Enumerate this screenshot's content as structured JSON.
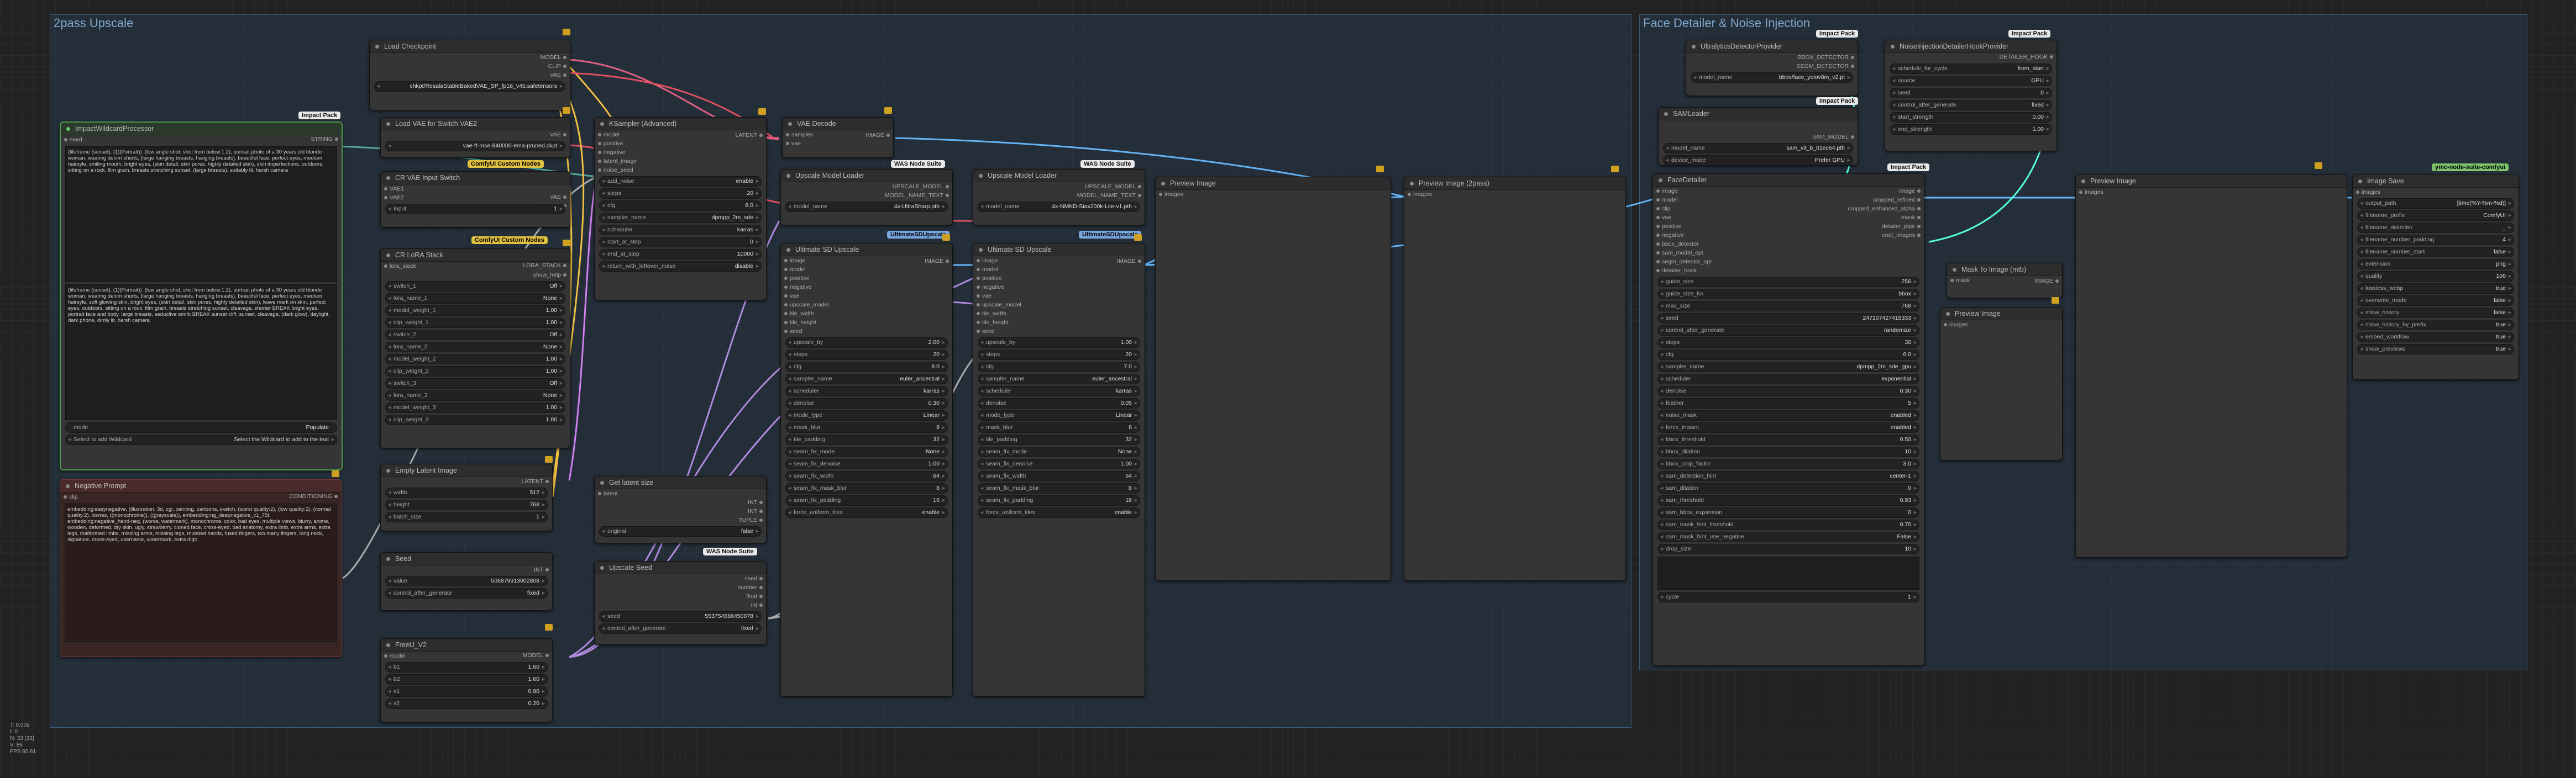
{
  "groups": {
    "upscale_title": "2pass Upscale",
    "face_title": "Face Detailer & Noise Injection"
  },
  "badges": {
    "impact_pack": "Impact Pack",
    "was_node_suite": "WAS Node Suite",
    "comfyui_custom_nodes": "ComfyUI Custom Nodes",
    "ultimate_sd_upscale": "UltimateSDUpscale",
    "ymc_node_suite": "ymc-node-suite-comfyui"
  },
  "nodes": {
    "load_checkpoint": {
      "title": "Load Checkpoint",
      "outputs": [
        "MODEL",
        "CLIP",
        "VAE"
      ],
      "ckpt_name": "chkpt/ResalaStableBakedVAE_SP_fp16_v45.safetensors"
    },
    "load_vae": {
      "title": "Load VAE for Switch VAE2",
      "output": "VAE",
      "vae_name": "vae-ft-mse-840000-ema-pruned.ckpt"
    },
    "vae_switch": {
      "title": "CR VAE Input Switch",
      "inputs": [
        "VAE1",
        "VAE2"
      ],
      "outputs": [
        "VAE",
        "show_help"
      ],
      "input_label": "Input",
      "input_value": "1"
    },
    "lora_stack": {
      "title": "CR LoRA Stack",
      "input": "lora_stack",
      "outputs": [
        "LORA_STACK",
        "show_help"
      ],
      "rows": [
        {
          "label": "switch_1",
          "value": "Off"
        },
        {
          "label": "lora_name_1",
          "value": "None"
        },
        {
          "label": "model_weight_1",
          "value": "1.00"
        },
        {
          "label": "clip_weight_1",
          "value": "1.00"
        },
        {
          "label": "switch_2",
          "value": "Off"
        },
        {
          "label": "lora_name_2",
          "value": "None"
        },
        {
          "label": "model_weight_2",
          "value": "1.00"
        },
        {
          "label": "clip_weight_2",
          "value": "1.00"
        },
        {
          "label": "switch_3",
          "value": "Off"
        },
        {
          "label": "lora_name_3",
          "value": "None"
        },
        {
          "label": "model_weight_3",
          "value": "1.00"
        },
        {
          "label": "clip_weight_3",
          "value": "1.00"
        }
      ]
    },
    "wildcard": {
      "title": "ImpactWildcardProcessor",
      "input": "seed",
      "output": "STRING",
      "text1": "(lifeframe (sunset), (1)(Portrait)) ,(low angle shot, shot from below:1.2), portrait photo of a 30 years old blonde woman, wearing denim shorts, (large hanging breasts, hanging breasts), beautiful face, perfect eyes, medium hairsyle, smiling mouth, bright eyes, (skin detail, skin pores, highly detailed skin), skin imperfections, outdoors, sitting on a rock, film grain, breasts stretching sunset, (large breasts), suitably lit, harsh camera",
      "text2": "(lifeframe (sunset), (1)(Portrait)) ,(low angle shot, shot from below:1.2), portrait photo of a 30 years old blonde woman, wearing denim shorts, (large hanging breasts, hanging breasts), beautiful face, perfect eyes, medium hairsyle, soft glowing skin, bright eyes, (skin detail, skin pores, highly detailed skin), leave mark on skin, perfect eyes, outdoors, sitting on a rock, film grain, breasts stretching sunset, cleavage, shorter BREAK bright eyes, portrait face and body, large breasts, seductive smirk BREAK sunset cliff, sunset, cleavage, (dark glow), daylight, dark phone, dimly lit, harsh camera",
      "mode_label": "mode",
      "mode_value": "Populate",
      "select_label": "Select to add Wildcard",
      "select_value": "Select the Wildcard to add to the text"
    },
    "negative": {
      "title": "Negative Prompt",
      "input": "clip",
      "output": "CONDITIONING",
      "text": "embedding:easynegative, (illustration, 3d, cgi, painting, cartoons, sketch, (worst quality:2), (low quality:2), (normal quality:2), lowres, ((monochrome)), ((grayscale)), embedding:ng_deepnegative_v1_75t, embedding:negative_hand-neg, (worse, watermark), monochrome, color, bad eyes, multiple views, blurry, anime, wooden, deformed, dry skin, ugly, strawberry, cloned face, cross-eyed, bad anatomy, extra limb, extra arms, extra legs, malformed limbs, missing arms, missing legs, mutated hands, fused fingers, too many fingers, long neck, signature, cross-eyed, username, watermark, extra digit"
    },
    "ksampler": {
      "title": "KSampler (Advanced)",
      "inputs": [
        "model",
        "positive",
        "negative",
        "latent_image",
        "noise_seed"
      ],
      "output": "LATENT",
      "rows": [
        {
          "label": "add_noise",
          "value": "enable"
        },
        {
          "label": "steps",
          "value": "20"
        },
        {
          "label": "cfg",
          "value": "8.0"
        },
        {
          "label": "sampler_name",
          "value": "dpmpp_2m_sde"
        },
        {
          "label": "scheduler",
          "value": "karras"
        },
        {
          "label": "start_at_step",
          "value": "0"
        },
        {
          "label": "end_at_step",
          "value": "10000"
        },
        {
          "label": "return_with_leftover_noise",
          "value": "disable"
        }
      ]
    },
    "vae_decode": {
      "title": "VAE Decode",
      "inputs": [
        "samples",
        "vae"
      ],
      "output": "IMAGE"
    },
    "empty_latent": {
      "title": "Empty Latent Image",
      "output": "LATENT",
      "rows": [
        {
          "label": "width",
          "value": "512"
        },
        {
          "label": "height",
          "value": "768"
        },
        {
          "label": "batch_size",
          "value": "1"
        }
      ]
    },
    "get_latent_size": {
      "title": "Get latent size",
      "input": "latent",
      "outputs": [
        "INT",
        "INT",
        "TUPLE"
      ],
      "original_label": "original",
      "original_value": "false"
    },
    "seed": {
      "title": "Seed",
      "output": "INT",
      "rows": [
        {
          "label": "value",
          "value": "506879913002808"
        },
        {
          "label": "control_after_generate",
          "value": "fixed"
        }
      ]
    },
    "upscale_seed": {
      "title": "Upscale Seed",
      "outputs": [
        "seed",
        "number",
        "float",
        "int"
      ],
      "rows": [
        {
          "label": "seed",
          "value": "553754686450678"
        },
        {
          "label": "control_after_generate",
          "value": "fixed"
        }
      ]
    },
    "freeu": {
      "title": "FreeU_V2",
      "input": "model",
      "output": "MODEL",
      "rows": [
        {
          "label": "b1",
          "value": "1.60"
        },
        {
          "label": "b2",
          "value": "1.60"
        },
        {
          "label": "s1",
          "value": "0.90"
        },
        {
          "label": "s2",
          "value": "0.20"
        }
      ]
    },
    "upscale_model_loader_1": {
      "title": "Upscale Model Loader",
      "outputs": [
        "UPSCALE_MODEL",
        "MODEL_NAME_TEXT"
      ],
      "model_label": "model_name",
      "model_value": "4x-UltraSharp.pth"
    },
    "upscale_model_loader_2": {
      "title": "Upscale Model Loader",
      "outputs": [
        "UPSCALE_MODEL",
        "MODEL_NAME_TEXT"
      ],
      "model_label": "model_name",
      "model_value": "4x-NMKD-Siax200k-Lite-v1.pth"
    },
    "ultimate_1": {
      "title": "Ultimate SD Upscale",
      "inputs": [
        "image",
        "model",
        "positive",
        "negative",
        "vae",
        "upscale_model",
        "tile_width",
        "tile_height",
        "seed"
      ],
      "output": "IMAGE",
      "rows": [
        {
          "label": "upscale_by",
          "value": "2.00"
        },
        {
          "label": "steps",
          "value": "20"
        },
        {
          "label": "cfg",
          "value": "8.0"
        },
        {
          "label": "sampler_name",
          "value": "euler_ancestral"
        },
        {
          "label": "scheduler",
          "value": "karras"
        },
        {
          "label": "denoise",
          "value": "0.30"
        },
        {
          "label": "mode_type",
          "value": "Linear"
        },
        {
          "label": "mask_blur",
          "value": "8"
        },
        {
          "label": "tile_padding",
          "value": "32"
        },
        {
          "label": "seam_fix_mode",
          "value": "None"
        },
        {
          "label": "seam_fix_denoise",
          "value": "1.00"
        },
        {
          "label": "seam_fix_width",
          "value": "64"
        },
        {
          "label": "seam_fix_mask_blur",
          "value": "8"
        },
        {
          "label": "seam_fix_padding",
          "value": "16"
        },
        {
          "label": "force_uniform_tiles",
          "value": "enable"
        }
      ]
    },
    "ultimate_2": {
      "title": "Ultimate SD Upscale",
      "inputs": [
        "image",
        "model",
        "positive",
        "negative",
        "vae",
        "upscale_model",
        "tile_width",
        "tile_height",
        "seed"
      ],
      "output": "IMAGE",
      "rows": [
        {
          "label": "upscale_by",
          "value": "1.00"
        },
        {
          "label": "steps",
          "value": "20"
        },
        {
          "label": "cfg",
          "value": "7.0"
        },
        {
          "label": "sampler_name",
          "value": "euler_ancestral"
        },
        {
          "label": "scheduler",
          "value": "karras"
        },
        {
          "label": "denoise",
          "value": "0.05"
        },
        {
          "label": "mode_type",
          "value": "Linear"
        },
        {
          "label": "mask_blur",
          "value": "8"
        },
        {
          "label": "tile_padding",
          "value": "32"
        },
        {
          "label": "seam_fix_mode",
          "value": "None"
        },
        {
          "label": "seam_fix_denoise",
          "value": "1.00"
        },
        {
          "label": "seam_fix_width",
          "value": "64"
        },
        {
          "label": "seam_fix_mask_blur",
          "value": "8"
        },
        {
          "label": "seam_fix_padding",
          "value": "16"
        },
        {
          "label": "force_uniform_tiles",
          "value": "enable"
        }
      ]
    },
    "preview_1": {
      "title": "Preview Image",
      "input": "images"
    },
    "preview_2": {
      "title": "Preview Image (2pass)",
      "input": "images"
    },
    "ultralytics": {
      "title": "UltralyticsDetectorProvider",
      "outputs": [
        "BBOX_DETECTOR",
        "SEGM_DETECTOR"
      ],
      "model_label": "model_name",
      "model_value": "bbox/face_yolov8m_v2.pt"
    },
    "noise_injection": {
      "title": "NoiseInjectionDetailerHookProvider",
      "output": "DETAILER_HOOK",
      "rows": [
        {
          "label": "schedule_for_cycle",
          "value": "from_start"
        },
        {
          "label": "source",
          "value": "GPU"
        },
        {
          "label": "seed",
          "value": "0"
        },
        {
          "label": "control_after_generate",
          "value": "fixed"
        },
        {
          "label": "start_strength",
          "value": "0.00"
        },
        {
          "label": "end_strength",
          "value": "1.00"
        }
      ]
    },
    "sam_loader": {
      "title": "SAMLoader",
      "output": "SAM_MODEL",
      "rows": [
        {
          "label": "model_name",
          "value": "sam_vit_b_01ec64.pth"
        },
        {
          "label": "device_mode",
          "value": "Prefer GPU"
        }
      ]
    },
    "face_detailer": {
      "title": "FaceDetailer",
      "inputs": [
        "image",
        "model",
        "clip",
        "vae",
        "positive",
        "negative",
        "bbox_detector",
        "sam_model_opt",
        "segm_detector_opt",
        "detailer_hook"
      ],
      "outputs": [
        "image",
        "cropped_refined",
        "cropped_enhanced_alpha",
        "mask",
        "detailer_pipe",
        "cnet_images"
      ],
      "rows": [
        {
          "label": "guide_size",
          "value": "256"
        },
        {
          "label": "guide_size_for",
          "value": "bbox"
        },
        {
          "label": "max_size",
          "value": "768"
        },
        {
          "label": "seed",
          "value": "247107427418333"
        },
        {
          "label": "control_after_generate",
          "value": "randomize"
        },
        {
          "label": "steps",
          "value": "30"
        },
        {
          "label": "cfg",
          "value": "6.0"
        },
        {
          "label": "sampler_name",
          "value": "dpmpp_2m_sde_gpu"
        },
        {
          "label": "scheduler",
          "value": "exponential"
        },
        {
          "label": "denoise",
          "value": "0.30"
        },
        {
          "label": "feather",
          "value": "5"
        },
        {
          "label": "noise_mask",
          "value": "enabled"
        },
        {
          "label": "force_inpaint",
          "value": "enabled"
        },
        {
          "label": "bbox_threshold",
          "value": "0.50"
        },
        {
          "label": "bbox_dilation",
          "value": "10"
        },
        {
          "label": "bbox_crop_factor",
          "value": "3.0"
        },
        {
          "label": "sam_detection_hint",
          "value": "center-1"
        },
        {
          "label": "sam_dilation",
          "value": "0"
        },
        {
          "label": "sam_threshold",
          "value": "0.93"
        },
        {
          "label": "sam_bbox_expansion",
          "value": "0"
        },
        {
          "label": "sam_mask_hint_threshold",
          "value": "0.70"
        },
        {
          "label": "sam_mask_hint_use_negative",
          "value": "False"
        },
        {
          "label": "drop_size",
          "value": "10"
        }
      ],
      "cycle_label": "cycle",
      "cycle_value": "1"
    },
    "mask_to_image": {
      "title": "Mask To Image (mtb)",
      "input": "mask",
      "output": "IMAGE"
    },
    "preview_3": {
      "title": "Preview Image",
      "input": "images"
    },
    "preview_4": {
      "title": "Preview Image",
      "input": "images"
    },
    "image_save": {
      "title": "Image Save",
      "input": "images",
      "rows": [
        {
          "label": "output_path",
          "value": "[time(%Y-%m-%d)]"
        },
        {
          "label": "filename_prefix",
          "value": "ComfyUI"
        },
        {
          "label": "filename_delimiter",
          "value": "_"
        },
        {
          "label": "filename_number_padding",
          "value": "4"
        },
        {
          "label": "filename_number_start",
          "value": "false"
        },
        {
          "label": "extension",
          "value": "png"
        },
        {
          "label": "quality",
          "value": "100"
        },
        {
          "label": "lossless_webp",
          "value": "true"
        },
        {
          "label": "overwrite_mode",
          "value": "false"
        },
        {
          "label": "show_history",
          "value": "false"
        },
        {
          "label": "show_history_by_prefix",
          "value": "true"
        },
        {
          "label": "embed_workflow",
          "value": "true"
        },
        {
          "label": "show_previews",
          "value": "true"
        }
      ]
    }
  },
  "status_text": "T: 0.00s\nI: 0\nN: 33 [33]\nV: 86\nFPS:60.61"
}
